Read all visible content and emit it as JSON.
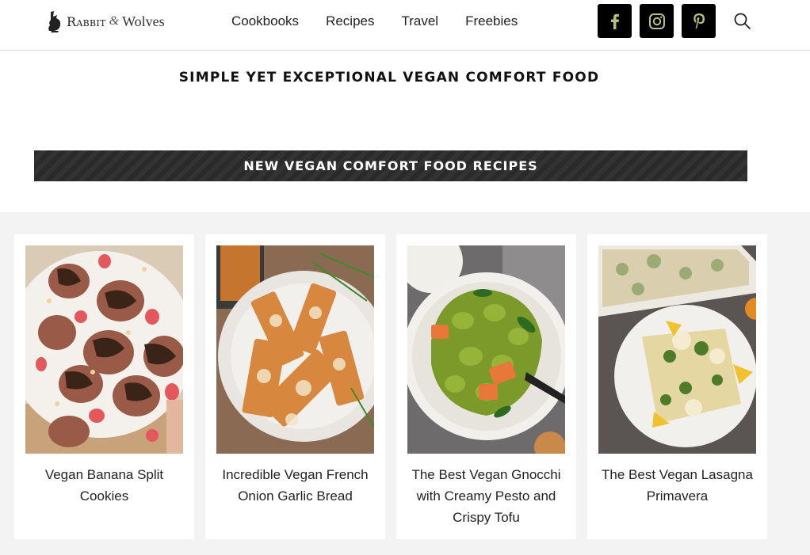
{
  "brand": {
    "name_part1": "Rabbit",
    "ampersand": "&",
    "name_part2": "Wolves",
    "logo_icon": "rabbit-icon"
  },
  "nav": [
    "Cookbooks",
    "Recipes",
    "Travel",
    "Freebies"
  ],
  "social": [
    {
      "name": "facebook-icon",
      "glyph": "f"
    },
    {
      "name": "instagram-icon",
      "glyph": ""
    },
    {
      "name": "pinterest-icon",
      "glyph": "P"
    }
  ],
  "social_icon_color": "#b5c27a",
  "search_icon": "search-icon",
  "tagline": "SIMPLE YET EXCEPTIONAL VEGAN COMFORT FOOD",
  "banner": "NEW VEGAN COMFORT FOOD RECIPES",
  "recipes": [
    {
      "title": "Vegan Banana Split Cookies"
    },
    {
      "title": "Incredible Vegan French Onion Garlic Bread"
    },
    {
      "title": "The Best Vegan Gnocchi with Creamy Pesto and Crispy Tofu"
    },
    {
      "title": "The Best Vegan Lasagna Primavera"
    }
  ]
}
